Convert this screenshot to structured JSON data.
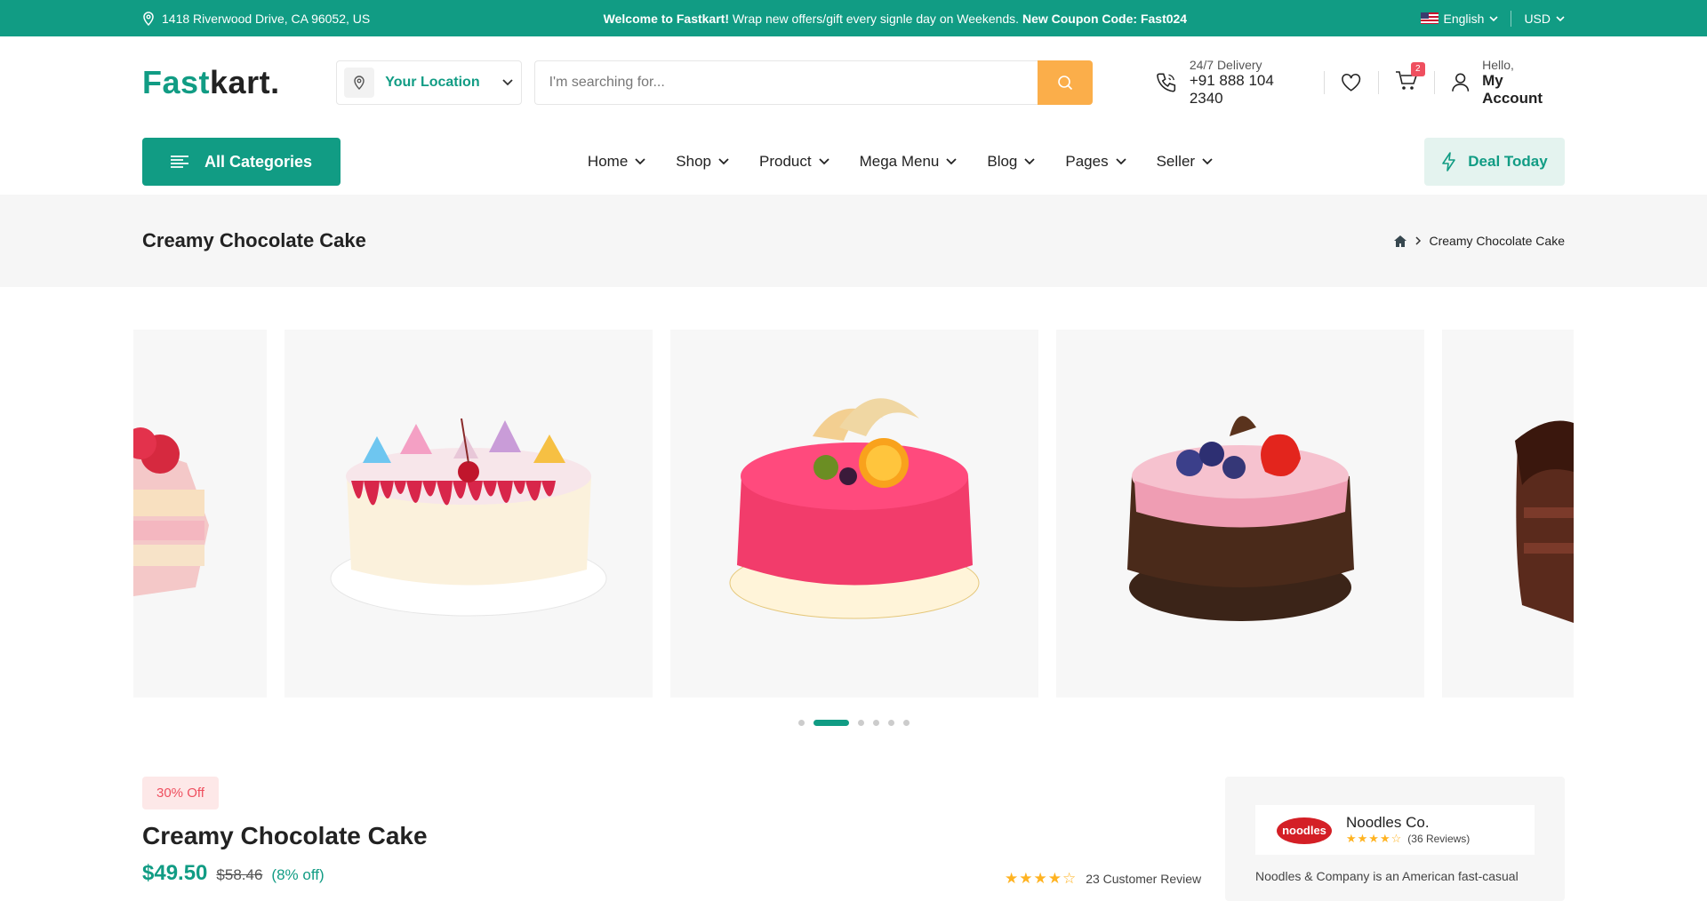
{
  "topbar": {
    "address": "1418 Riverwood Drive, CA 96052, US",
    "welcome_bold": "Welcome to Fastkart!",
    "welcome_text": " Wrap new offers/gift every signle day on Weekends. ",
    "coupon": "New Coupon Code: Fast024",
    "language": "English",
    "currency": "USD"
  },
  "header": {
    "logo_part1": "Fast",
    "logo_part2": "kart.",
    "location_label": "Your Location",
    "search_placeholder": "I'm searching for...",
    "delivery_label": "24/7 Delivery",
    "delivery_phone": "+91 888 104 2340",
    "cart_count": "2",
    "account_greeting": "Hello,",
    "account_label": "My Account"
  },
  "nav": {
    "all_categories": "All Categories",
    "menu": [
      "Home",
      "Shop",
      "Product",
      "Mega Menu",
      "Blog",
      "Pages",
      "Seller"
    ],
    "deal_today": "Deal Today"
  },
  "breadcrumb": {
    "title": "Creamy Chocolate Cake",
    "current": "Creamy Chocolate Cake"
  },
  "carousel": {
    "slide_count": 6,
    "active_index": 1
  },
  "product": {
    "discount_badge": "30% Off",
    "title": "Creamy Chocolate Cake",
    "price": "$49.50",
    "old_price": "$58.46",
    "percent_off": "(8% off)",
    "rating": 4,
    "review_text": "23 Customer Review"
  },
  "vendor": {
    "logo_text": "noodles",
    "name": "Noodles Co.",
    "rating": 4,
    "reviews": "(36 Reviews)",
    "description": "Noodles & Company is an American fast-casual"
  },
  "colors": {
    "brand": "#119c84",
    "search_button": "#fbae4a",
    "badge": "#ef4f5f"
  }
}
